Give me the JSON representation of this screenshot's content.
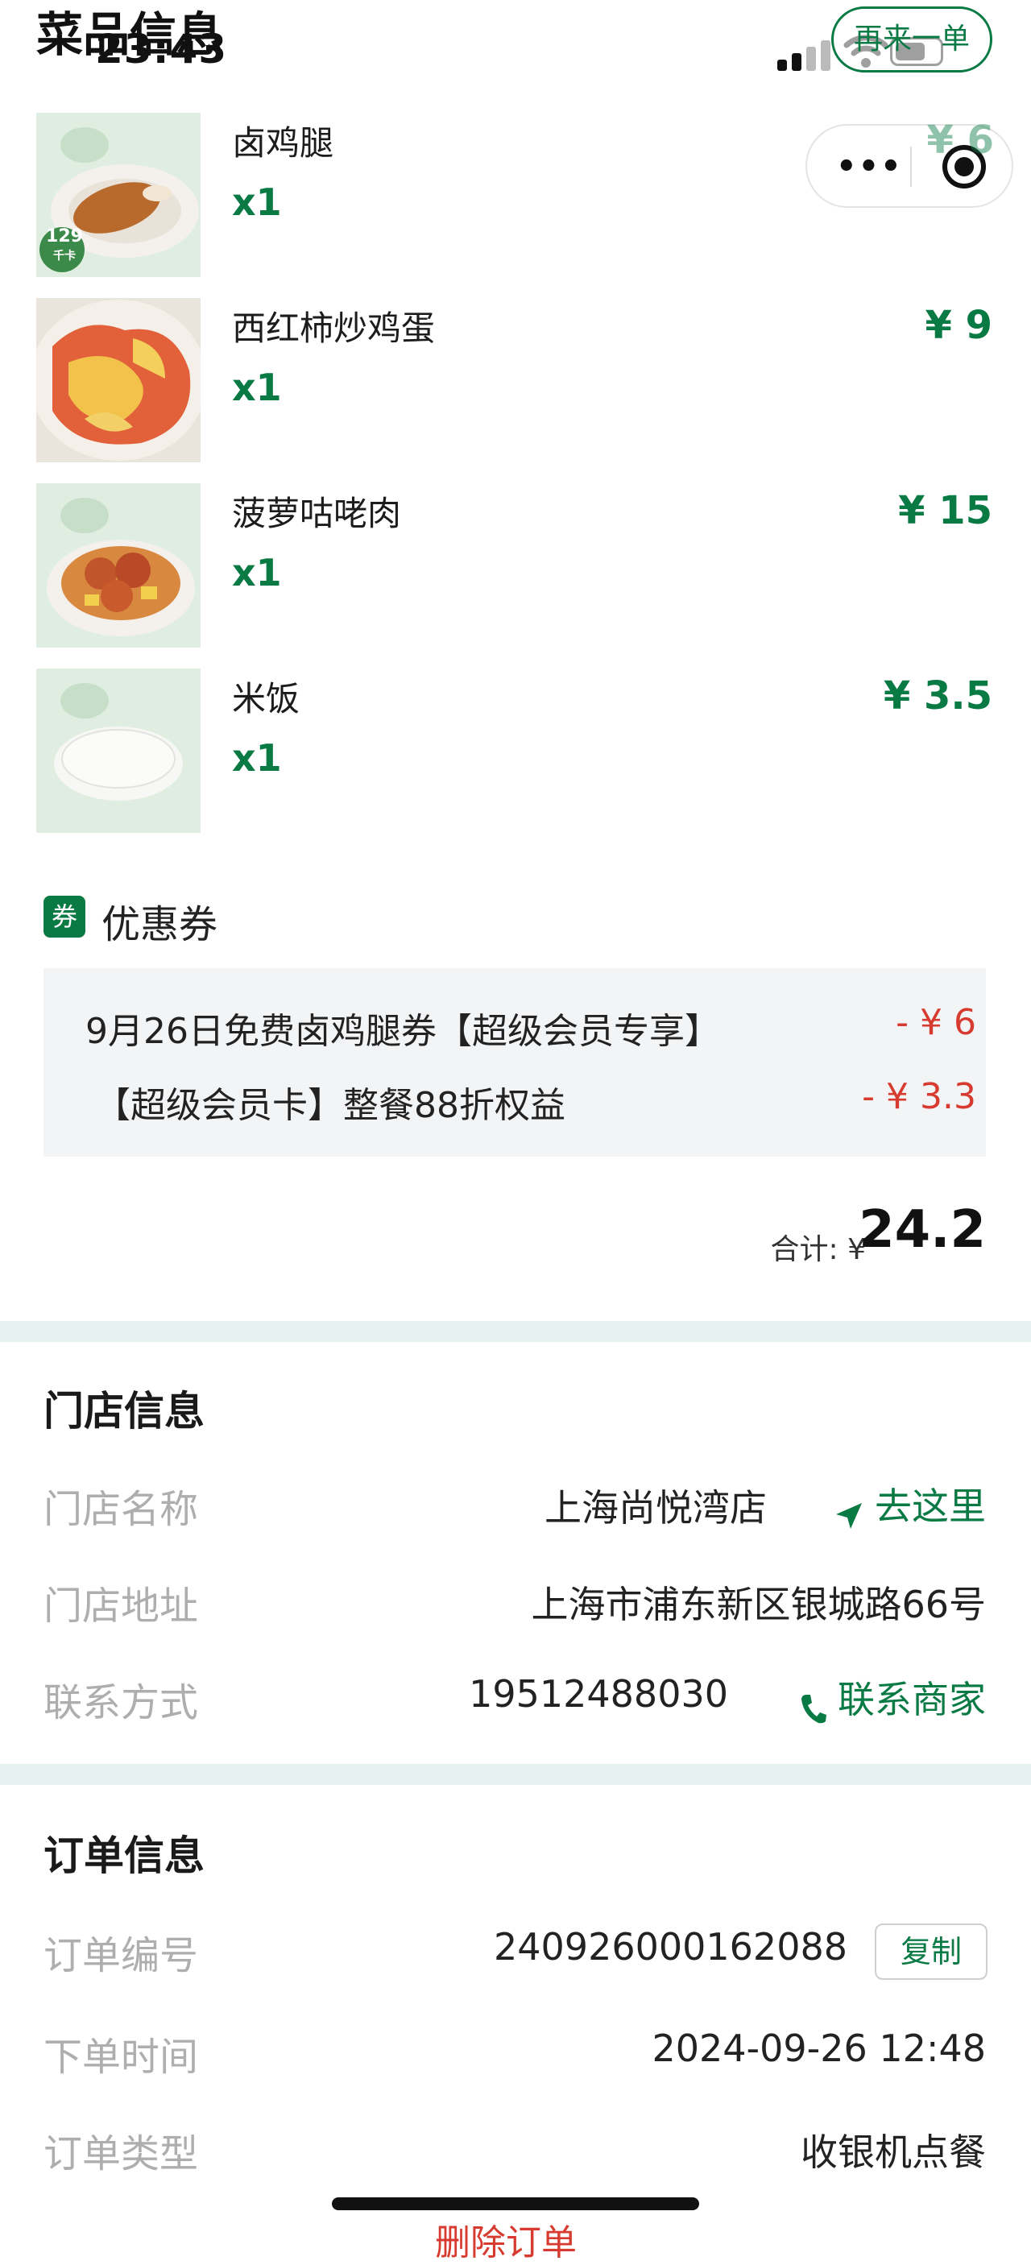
{
  "status_bar": {
    "time": "23:43"
  },
  "header": {
    "title": "菜品信息",
    "reorder_label": "再来一单"
  },
  "dishes": [
    {
      "name": "卤鸡腿",
      "qty": "x1",
      "price": "¥ 6",
      "badge": "129",
      "badge_sub": "千卡"
    },
    {
      "name": "西红柿炒鸡蛋",
      "qty": "x1",
      "price": "¥ 9"
    },
    {
      "name": "菠萝咕咾肉",
      "qty": "x1",
      "price": "¥ 15"
    },
    {
      "name": "米饭",
      "qty": "x1",
      "price": "¥ 3.5"
    }
  ],
  "coupons": {
    "badge": "券",
    "title": "优惠券",
    "items": [
      {
        "text": "9月26日免费卤鸡腿券【超级会员专享】",
        "amount": "- ¥ 6"
      },
      {
        "text": "【超级会员卡】整餐88折权益",
        "amount": "- ¥ 3.3"
      }
    ]
  },
  "total": {
    "label": "合计: ¥",
    "value": "24.2"
  },
  "store": {
    "title": "门店信息",
    "name_label": "门店名称",
    "name": "上海尚悦湾店",
    "navigate_label": "去这里",
    "address_label": "门店地址",
    "address": "上海市浦东新区银城路66号",
    "contact_label": "联系方式",
    "phone": "19512488030",
    "contact_link": "联系商家"
  },
  "order": {
    "title": "订单信息",
    "number_label": "订单编号",
    "number": "240926000162088",
    "copy_label": "复制",
    "time_label": "下单时间",
    "time": "2024-09-26 12:48",
    "type_label": "订单类型",
    "type": "收银机点餐"
  },
  "footer": {
    "delete_label": "删除订单"
  },
  "colors": {
    "accent": "#0a7a45",
    "discount": "#d73a2f",
    "band": "#e8f1f2"
  },
  "icons": [
    "more-dots-icon",
    "target-icon",
    "navigate-arrow-icon",
    "phone-icon",
    "wifi-icon",
    "battery-icon",
    "signal-icon"
  ]
}
